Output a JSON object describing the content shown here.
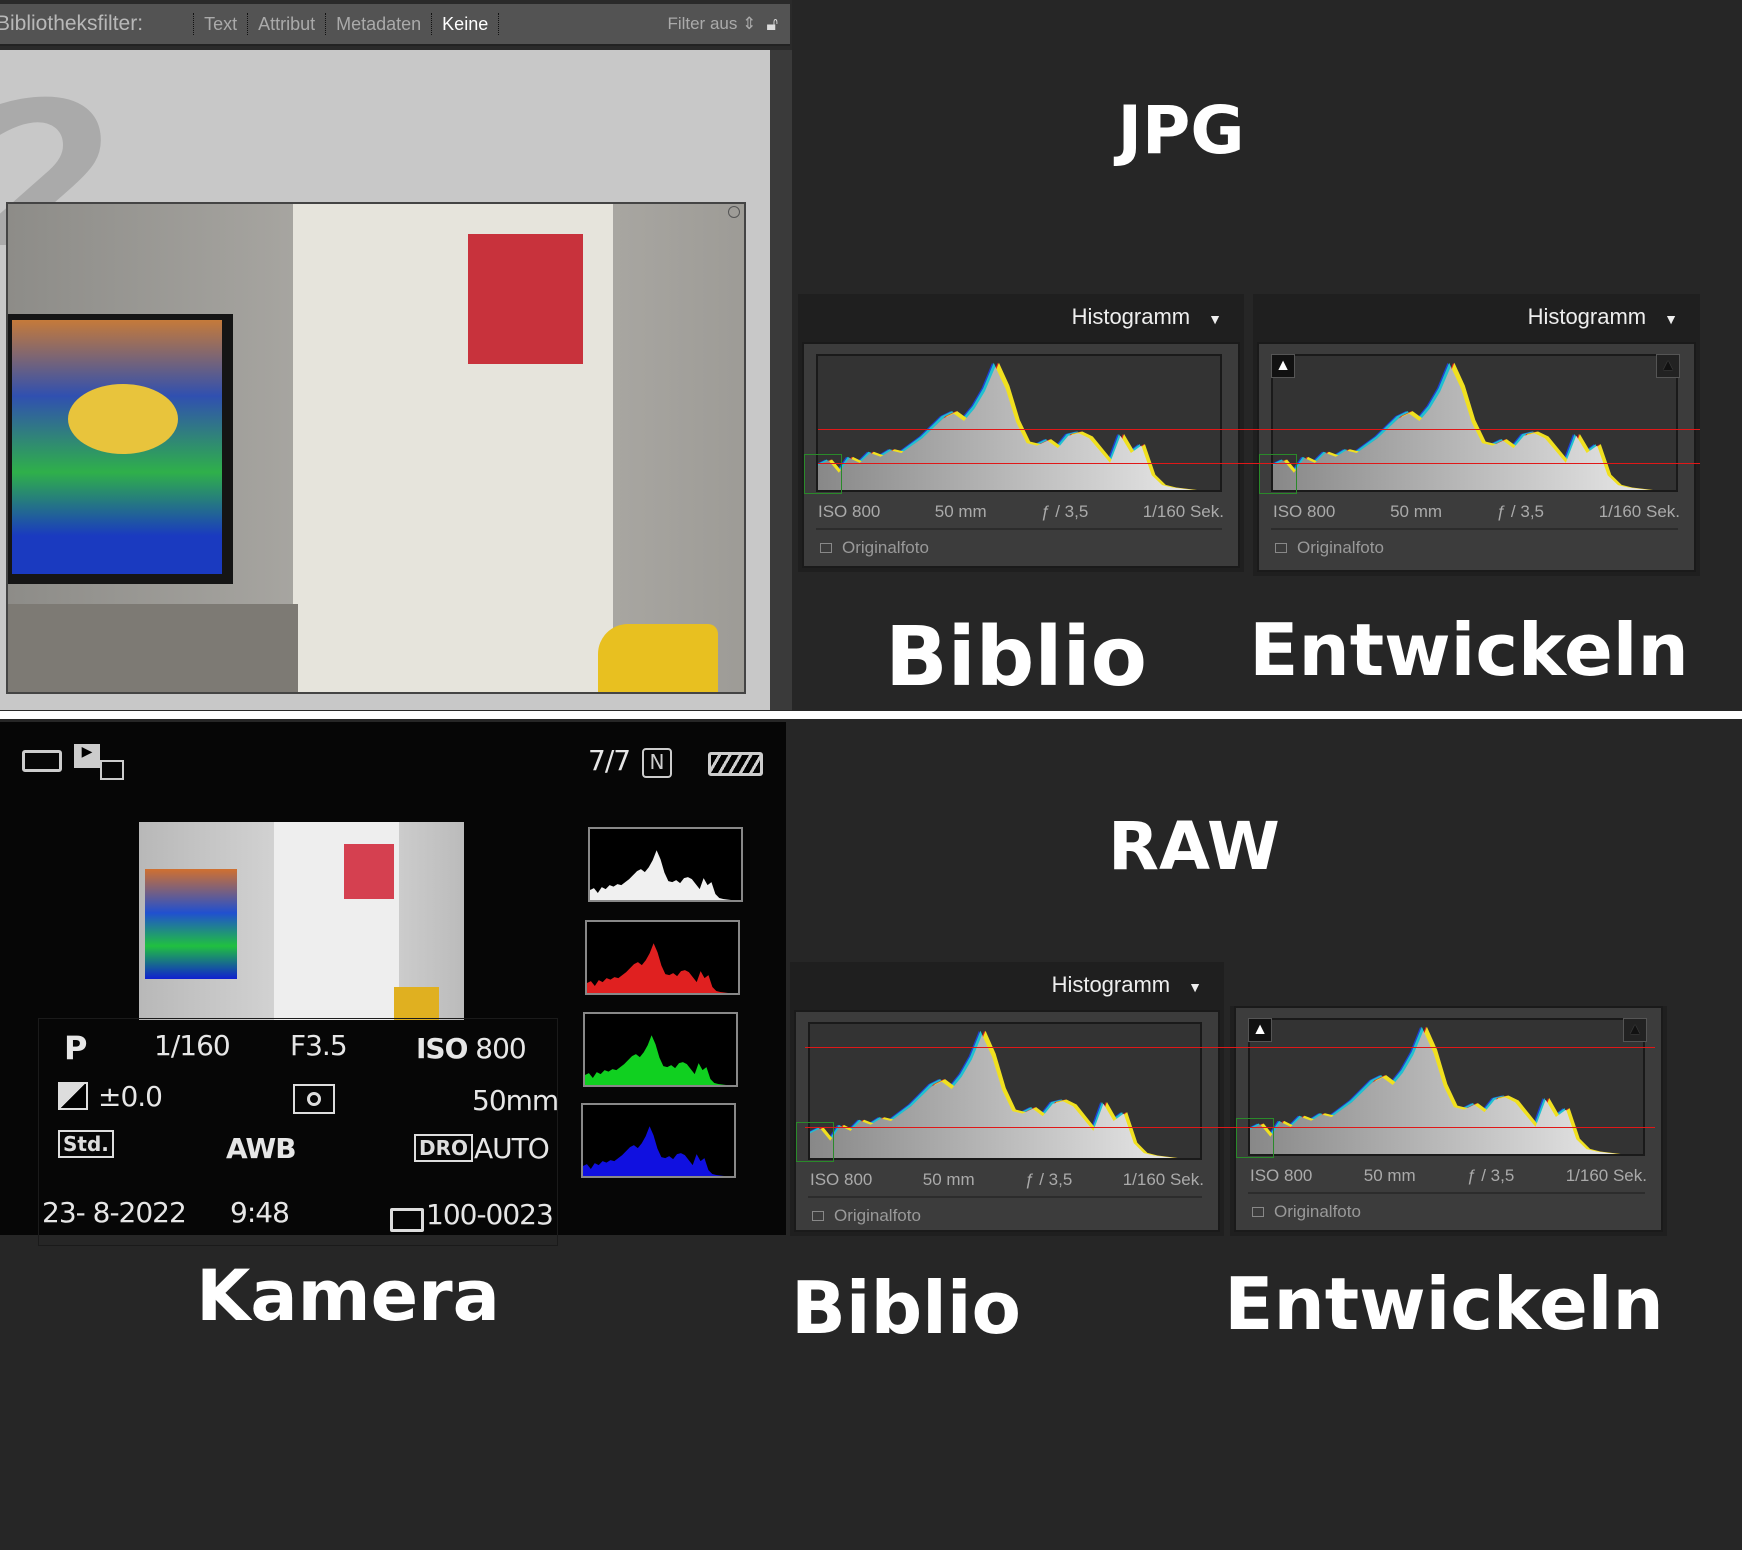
{
  "filter_bar": {
    "label": "Bibliotheksfilter:",
    "filters": [
      "Text",
      "Attribut",
      "Metadaten",
      "Keine"
    ],
    "active": "Keine",
    "filter_state": "Filter aus",
    "lock_icon": "padlock-open"
  },
  "labels": {
    "jpg": "JPG",
    "raw": "RAW",
    "biblio": "Biblio",
    "entwickeln": "Entwickeln",
    "kamera": "Kamera"
  },
  "histogram_panels": [
    {
      "id": "jpg-biblio",
      "title": "Histogramm",
      "iso": "ISO 800",
      "focal": "50 mm",
      "aperture": "ƒ / 3,5",
      "shutter": "1/160 Sek.",
      "original": "Originalfoto",
      "clipping_indicators": false
    },
    {
      "id": "jpg-entwickeln",
      "title": "Histogramm",
      "iso": "ISO 800",
      "focal": "50 mm",
      "aperture": "ƒ / 3,5",
      "shutter": "1/160 Sek.",
      "original": "Originalfoto",
      "clipping_indicators": true
    },
    {
      "id": "raw-biblio",
      "title": "Histogramm",
      "iso": "ISO 800",
      "focal": "50 mm",
      "aperture": "ƒ / 3,5",
      "shutter": "1/160 Sek.",
      "original": "Originalfoto",
      "clipping_indicators": false
    },
    {
      "id": "raw-entwickeln",
      "iso": "ISO 800",
      "focal": "50 mm",
      "aperture": "ƒ / 3,5",
      "shutter": "1/160 Sek.",
      "original": "Originalfoto",
      "clipping_indicators": true
    }
  ],
  "camera": {
    "counter": "7/7",
    "mode": "P",
    "shutter": "1/160",
    "aperture": "F3.5",
    "iso_label": "ISO",
    "iso": "800",
    "exposure_comp": "±0.0",
    "focal": "50mm",
    "style": "Std.",
    "wb": "AWB",
    "dro_label": "DRO",
    "dro": "AUTO",
    "date": "23- 8-2022",
    "time": "9:48",
    "folder": "100-0023",
    "histogram_colors": [
      "#f0f0f0",
      "#e02020",
      "#10d020",
      "#1010e0"
    ]
  },
  "colors": {
    "guide_line": "#e01818",
    "panel_bg": "#3c3c3c",
    "background": "#262626"
  }
}
